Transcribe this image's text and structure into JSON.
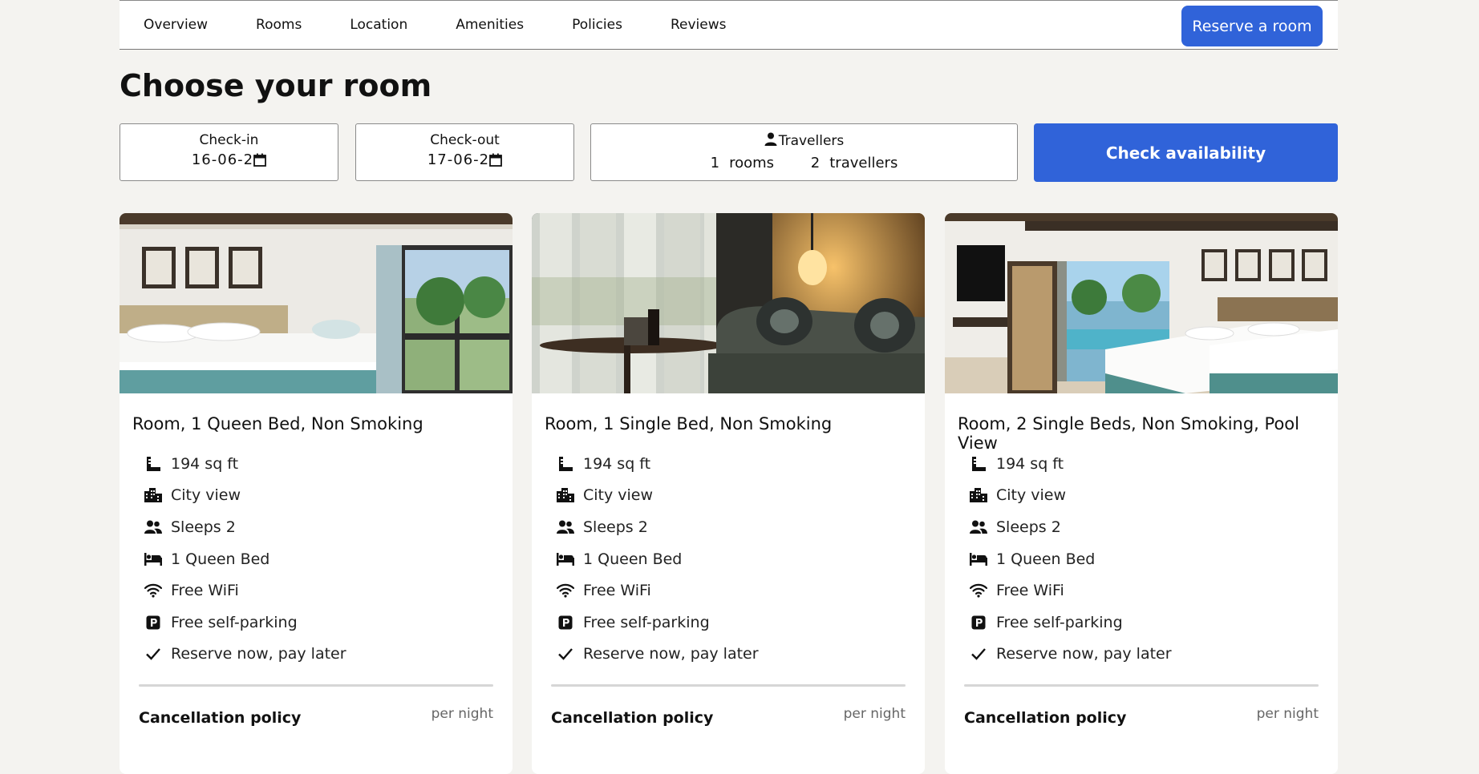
{
  "nav": {
    "tabs": [
      "Overview",
      "Rooms",
      "Location",
      "Amenities",
      "Policies",
      "Reviews"
    ],
    "reserve_label": "Reserve a room"
  },
  "page_title": "Choose your room",
  "search": {
    "checkin_label": "Check-in",
    "checkin_value": "16-06-2",
    "checkout_label": "Check-out",
    "checkout_value": "17-06-2",
    "travellers_label": "Travellers",
    "rooms_count": "1",
    "rooms_word": "rooms",
    "travellers_count": "2",
    "travellers_word": "travellers",
    "check_label": "Check availability"
  },
  "rooms": [
    {
      "name": "Room, 1 Queen Bed, Non Smoking",
      "features": [
        "194 sq ft",
        "City view",
        "Sleeps 2",
        "1 Queen Bed",
        "Free WiFi",
        "Free self-parking",
        "Reserve now, pay later"
      ],
      "cancellation_label": "Cancellation policy",
      "per_night": "per night"
    },
    {
      "name": "Room, 1 Single Bed, Non Smoking",
      "features": [
        "194 sq ft",
        "City view",
        "Sleeps 2",
        "1 Queen Bed",
        "Free WiFi",
        "Free self-parking",
        "Reserve now, pay later"
      ],
      "cancellation_label": "Cancellation policy",
      "per_night": "per night"
    },
    {
      "name": "Room, 2 Single Beds, Non Smoking, Pool View",
      "features": [
        "194 sq ft",
        "City view",
        "Sleeps 2",
        "1 Queen Bed",
        "Free WiFi",
        "Free self-parking",
        "Reserve now, pay later"
      ],
      "cancellation_label": "Cancellation policy",
      "per_night": "per night"
    }
  ],
  "feature_icons": [
    "ruler-icon",
    "city-icon",
    "people-icon",
    "bed-icon",
    "wifi-icon",
    "parking-icon",
    "check-icon"
  ],
  "colors": {
    "accent": "#3063d9",
    "background": "#f4f3f0"
  }
}
